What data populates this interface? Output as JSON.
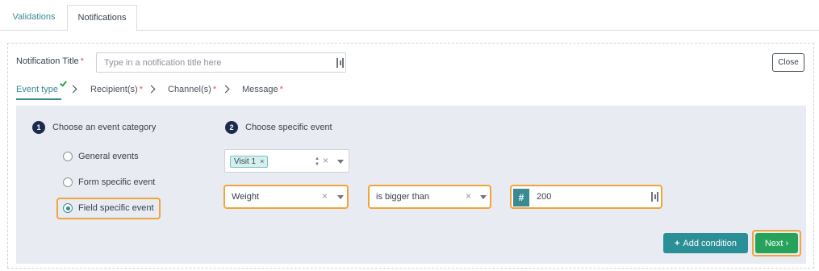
{
  "tabs": [
    {
      "label": "Validations",
      "active": false
    },
    {
      "label": "Notifications",
      "active": true
    }
  ],
  "notification_title": {
    "label": "Notification Title",
    "required_mark": "*",
    "placeholder": "Type in a notification title here",
    "value": ""
  },
  "close_label": "Close",
  "steps": [
    {
      "label": "Event type",
      "required": "",
      "completed": true
    },
    {
      "label": "Recipient(s)",
      "required": "*"
    },
    {
      "label": "Channel(s)",
      "required": "*"
    },
    {
      "label": "Message",
      "required": "*"
    }
  ],
  "section1": {
    "number": "1",
    "title": "Choose an event category",
    "options": [
      {
        "label": "General events",
        "checked": false
      },
      {
        "label": "Form specific event",
        "checked": false
      },
      {
        "label": "Field specific event",
        "checked": true
      }
    ]
  },
  "section2": {
    "number": "2",
    "title": "Choose specific event",
    "visit_tag": "Visit 1",
    "tag_remove": "×",
    "clear_symbol": "×",
    "field_value": "Weight",
    "operator_value": "is bigger than",
    "number_prefix": "#",
    "number_value": "200"
  },
  "buttons": {
    "add_condition_icon": "+",
    "add_condition": "Add condition",
    "next": "Next",
    "next_icon": "›"
  },
  "colors": {
    "accent_teal": "#3a8a93",
    "highlight_orange": "#f0a43a",
    "next_green": "#26a25b",
    "required_red": "#e1555a"
  }
}
